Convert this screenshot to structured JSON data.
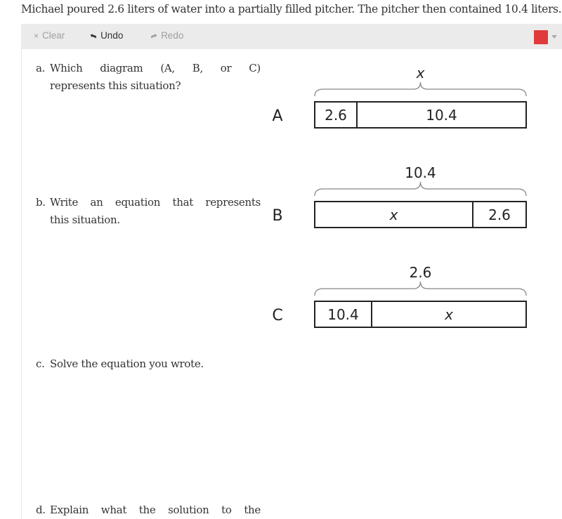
{
  "prompt": "Michael poured 2.6 liters of water into a partially filled pitcher. The pitcher then contained 10.4 liters.",
  "toolbar": {
    "clear": {
      "icon": "×",
      "label": "Clear",
      "enabled": false
    },
    "undo": {
      "icon": "➦",
      "label": "Undo",
      "enabled": true
    },
    "redo": {
      "icon": "➦",
      "label": "Redo",
      "enabled": false
    },
    "pen_color": "#e03a3a"
  },
  "questions": {
    "a": {
      "label": "a.",
      "line1": "Which diagram (A, B, or C)",
      "line2": "represents this situation?"
    },
    "b": {
      "label": "b.",
      "line1": "Write an equation that represents",
      "line2": "this situation."
    },
    "c": {
      "label": "c.",
      "line1": "Solve the equation you wrote."
    },
    "d": {
      "label": "d.",
      "line1": "Explain what the solution to the"
    }
  },
  "diagrams": [
    {
      "label": "A",
      "total": "x",
      "parts": [
        {
          "text": "2.6",
          "italic": false
        },
        {
          "text": "10.4",
          "italic": false
        }
      ]
    },
    {
      "label": "B",
      "total": "10.4",
      "parts": [
        {
          "text": "x",
          "italic": true
        },
        {
          "text": "2.6",
          "italic": false
        }
      ]
    },
    {
      "label": "C",
      "total": "2.6",
      "parts": [
        {
          "text": "10.4",
          "italic": false
        },
        {
          "text": "x",
          "italic": true
        }
      ]
    }
  ]
}
